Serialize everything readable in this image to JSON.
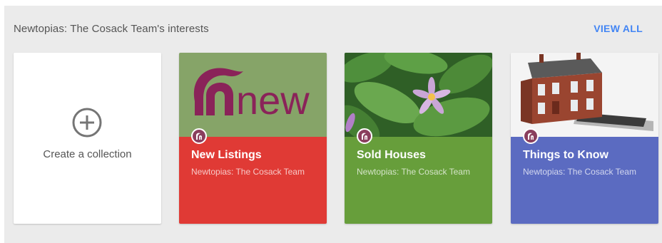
{
  "section": {
    "title": "Newtopias: The Cosack Team's interests",
    "view_all": "VIEW ALL"
  },
  "create_card": {
    "label": "Create a collection",
    "icon": "add-circle-icon"
  },
  "collections": [
    {
      "title": "New Listings",
      "owner": "Newtopias: The Cosack Team",
      "footer_color": "#e03a35",
      "image_bg": "#86a468",
      "image_text": "new",
      "image_text_color": "#8a2359"
    },
    {
      "title": "Sold Houses",
      "owner": "Newtopias: The Cosack Team",
      "footer_color": "#679e3b",
      "image_bg": "#3e7a33"
    },
    {
      "title": "Things to Know",
      "owner": "Newtopias: The Cosack Team",
      "footer_color": "#5b6bc1",
      "image_bg": "#f2f2f2"
    }
  ]
}
